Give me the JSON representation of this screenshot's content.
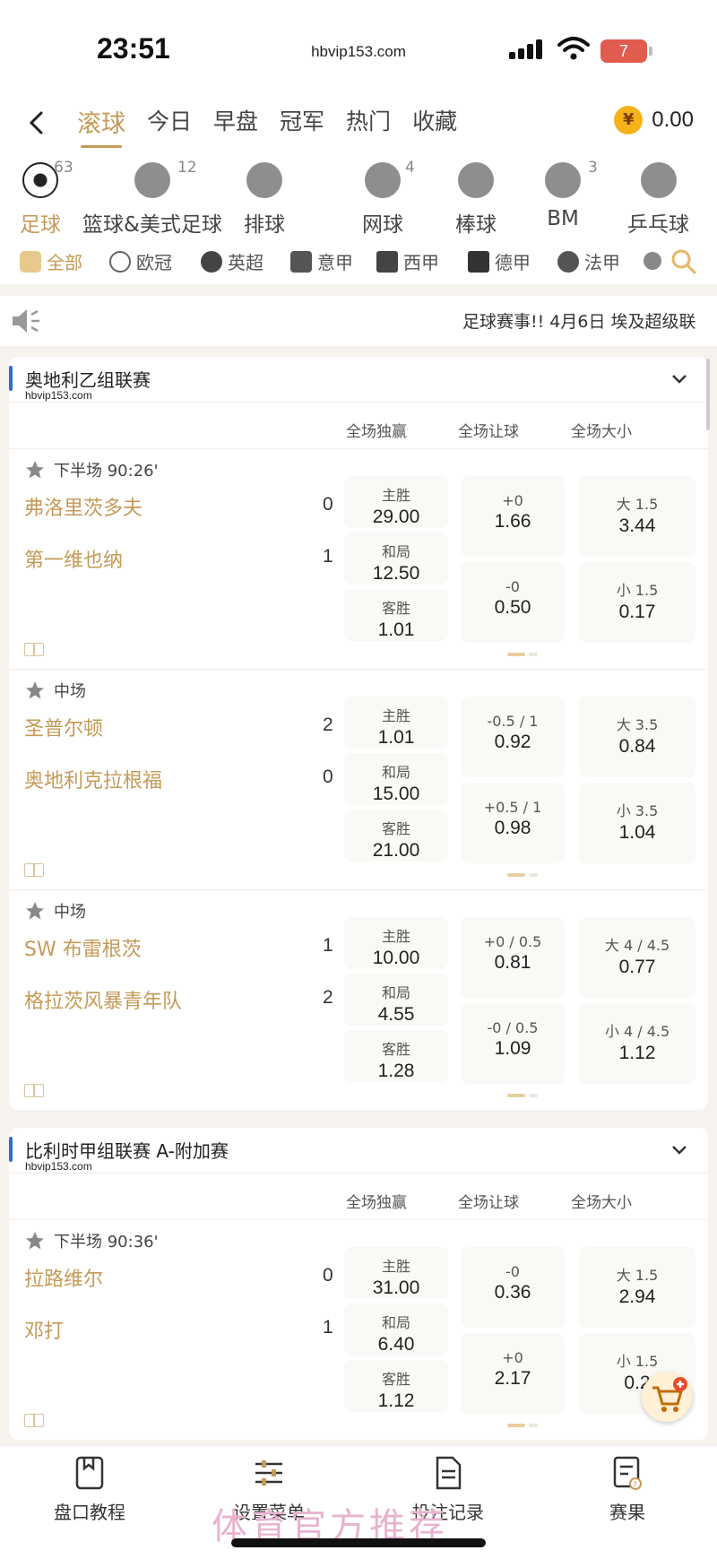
{
  "status": {
    "time": "23:51",
    "url": "hbvip153.com",
    "battery": "7"
  },
  "nav": {
    "tabs": [
      "滚球",
      "今日",
      "早盘",
      "冠军",
      "热门",
      "收藏"
    ],
    "balance": "0.00"
  },
  "sports": [
    {
      "label": "足球",
      "count": "63"
    },
    {
      "label": "篮球&美式足球",
      "count": "12"
    },
    {
      "label": "排球",
      "count": ""
    },
    {
      "label": "网球",
      "count": "4"
    },
    {
      "label": "棒球",
      "count": ""
    },
    {
      "label": "BM",
      "count": "3"
    },
    {
      "label": "乒乓球",
      "count": ""
    }
  ],
  "leagues": [
    "全部",
    "欧冠",
    "英超",
    "意甲",
    "西甲",
    "德甲",
    "法甲"
  ],
  "notice": "足球赛事!! 4月6日 埃及超级联",
  "columns": [
    "全场独赢",
    "全场让球",
    "全场大小"
  ],
  "cards": [
    {
      "league": "奥地利乙组联赛",
      "watermark": "hbvip153.com",
      "matches": [
        {
          "phase": "下半场 90:26'",
          "home": "弗洛里茨多夫",
          "home_score": "0",
          "away": "第一维也纳",
          "away_score": "1",
          "win": [
            {
              "l": "主胜",
              "v": "29.00"
            },
            {
              "l": "和局",
              "v": "12.50"
            },
            {
              "l": "客胜",
              "v": "1.01"
            }
          ],
          "hcap": [
            {
              "l": "+0",
              "v": "1.66"
            },
            {
              "l": "-0",
              "v": "0.50"
            }
          ],
          "ou": [
            {
              "l": "大 1.5",
              "v": "3.44"
            },
            {
              "l": "小 1.5",
              "v": "0.17"
            }
          ]
        },
        {
          "phase": "中场",
          "home": "圣普尔顿",
          "home_score": "2",
          "away": "奥地利克拉根福",
          "away_score": "0",
          "win": [
            {
              "l": "主胜",
              "v": "1.01"
            },
            {
              "l": "和局",
              "v": "15.00"
            },
            {
              "l": "客胜",
              "v": "21.00"
            }
          ],
          "hcap": [
            {
              "l": "-0.5 / 1",
              "v": "0.92"
            },
            {
              "l": "+0.5 / 1",
              "v": "0.98"
            }
          ],
          "ou": [
            {
              "l": "大 3.5",
              "v": "0.84"
            },
            {
              "l": "小 3.5",
              "v": "1.04"
            }
          ]
        },
        {
          "phase": "中场",
          "home": "SW 布雷根茨",
          "home_score": "1",
          "away": "格拉茨风暴青年队",
          "away_score": "2",
          "win": [
            {
              "l": "主胜",
              "v": "10.00"
            },
            {
              "l": "和局",
              "v": "4.55"
            },
            {
              "l": "客胜",
              "v": "1.28"
            }
          ],
          "hcap": [
            {
              "l": "+0 / 0.5",
              "v": "0.81"
            },
            {
              "l": "-0 / 0.5",
              "v": "1.09"
            }
          ],
          "ou": [
            {
              "l": "大 4 / 4.5",
              "v": "0.77"
            },
            {
              "l": "小 4 / 4.5",
              "v": "1.12"
            }
          ]
        }
      ]
    },
    {
      "league": "比利时甲组联赛 A-附加赛",
      "watermark": "hbvip153.com",
      "matches": [
        {
          "phase": "下半场 90:36'",
          "home": "拉路维尔",
          "home_score": "0",
          "away": "邓打",
          "away_score": "1",
          "win": [
            {
              "l": "主胜",
              "v": "31.00"
            },
            {
              "l": "和局",
              "v": "6.40"
            },
            {
              "l": "客胜",
              "v": "1.12"
            }
          ],
          "hcap": [
            {
              "l": "-0",
              "v": "0.36"
            },
            {
              "l": "+0",
              "v": "2.17"
            }
          ],
          "ou": [
            {
              "l": "大 1.5",
              "v": "2.94"
            },
            {
              "l": "小 1.5",
              "v": "0.2"
            }
          ]
        }
      ]
    }
  ],
  "bottom": [
    "盘口教程",
    "设置菜单",
    "投注记录",
    "赛果"
  ],
  "watermark_text": "体育官方推荐",
  "colors": {
    "accent": "#c49a57",
    "league_bar": "#2b6fd6",
    "coin": "#f5b21b",
    "battery": "#e25b4f"
  }
}
